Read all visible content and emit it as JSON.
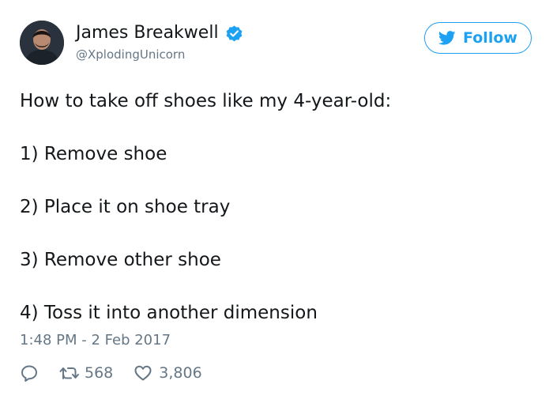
{
  "user": {
    "display_name": "James Breakwell",
    "handle": "@XplodingUnicorn",
    "verified_icon": "verified-badge-icon",
    "avatar_icon": "avatar"
  },
  "follow_button": {
    "label": "Follow",
    "icon": "twitter-bird-icon",
    "color": "#1da1f2"
  },
  "tweet": {
    "lines": [
      "How to take off shoes like my 4-year-old:",
      "1) Remove shoe",
      "2) Place it on shoe tray",
      "3) Remove other shoe",
      "4) Toss it into another dimension"
    ]
  },
  "timestamp": "1:48 PM - 2 Feb 2017",
  "actions": {
    "reply_icon": "reply-icon",
    "retweet_icon": "retweet-icon",
    "retweet_count": "568",
    "like_icon": "heart-icon",
    "like_count": "3,806"
  },
  "colors": {
    "text": "#14171a",
    "secondary": "#657786",
    "accent": "#1da1f2"
  }
}
